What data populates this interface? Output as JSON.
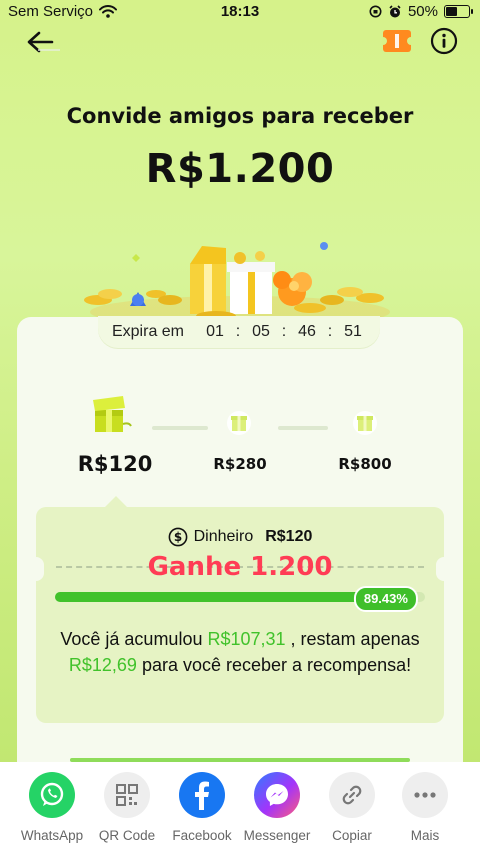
{
  "status_bar": {
    "carrier": "Sem Serviço",
    "time": "18:13",
    "battery_percent_text": "50%",
    "battery_level": 0.5
  },
  "nav": {
    "back_icon": "arrow-left-icon",
    "ticket_icon": "ticket-icon",
    "info_icon": "info-icon"
  },
  "hero": {
    "headline": "Convide amigos para receber",
    "amount": "R$1.200"
  },
  "expire": {
    "label": "Expira em",
    "days": "01",
    "hours": "05",
    "minutes": "46",
    "seconds": "51",
    "separator": ":"
  },
  "milestones": [
    {
      "label": "R$120",
      "active": true
    },
    {
      "label": "R$280",
      "active": false
    },
    {
      "label": "R$800",
      "active": false
    }
  ],
  "reward_panel": {
    "cash_label": "Dinheiro",
    "cash_value": "R$120",
    "win_text": "Ganhe 1.200",
    "progress_value": 0.8943,
    "progress_text": "89.43%",
    "message_prefix": "Você já acumulou ",
    "accumulated": "R$107,31",
    "message_mid": " , restam apenas ",
    "remaining": "R$12,69",
    "message_suffix": " para você receber a recompensa!"
  },
  "share": [
    {
      "label": "WhatsApp",
      "icon": "whatsapp-icon",
      "color": "#25D366"
    },
    {
      "label": "QR Code",
      "icon": "qr-code-icon",
      "color": "#eeeeee"
    },
    {
      "label": "Facebook",
      "icon": "facebook-icon",
      "color": "#1877F2"
    },
    {
      "label": "Messenger",
      "icon": "messenger-icon",
      "color": "#a334fa"
    },
    {
      "label": "Copiar",
      "icon": "link-icon",
      "color": "#eeeeee"
    },
    {
      "label": "Mais",
      "icon": "more-icon",
      "color": "#eeeeee"
    }
  ],
  "colors": {
    "accent_green": "#41c22b",
    "win_red": "#ff3c55"
  }
}
